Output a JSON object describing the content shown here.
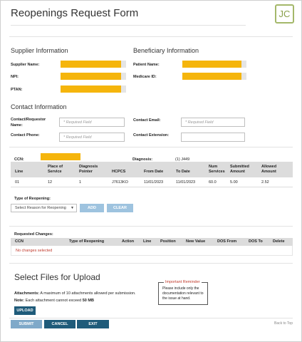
{
  "header": {
    "title": "Reopenings Request Form",
    "logo_text": "JC"
  },
  "supplier": {
    "heading": "Supplier Information",
    "name_label": "Supplier Name:",
    "npi_label": "NPI:",
    "ptan_label": "PTAN:"
  },
  "beneficiary": {
    "heading": "Beneficiary Information",
    "name_label": "Patient Name:",
    "medicare_label": "Medicare ID:"
  },
  "contact": {
    "heading": "Contact Information",
    "requestor_label": "Contact/Requestor Name:",
    "phone_label": "Contact Phone:",
    "email_label": "Contact Email:",
    "extension_label": "Contact Extension:",
    "placeholder": "* Required Field",
    "extension_value": ""
  },
  "claim": {
    "ccn_label": "CCN:",
    "diagnosis_label": "Diagnosis:",
    "diagnosis_value": "(1) J449",
    "columns": [
      "Line",
      "Place of Service",
      "Diagnosis Pointer",
      "HCPCS",
      "From Date",
      "To Date",
      "Num Services",
      "Submitted Amount",
      "Allowed Amount"
    ],
    "rows": [
      {
        "line": "01",
        "pos": "12",
        "pointer": "1",
        "hcpcs": "J7613KO",
        "from": "11/01/2023",
        "to": "11/01/2023",
        "num": "60.0",
        "submitted": "5.00",
        "allowed": "2.52"
      }
    ]
  },
  "reopening": {
    "type_label": "Type of Reopening:",
    "select_value": "Select Reason for Reopening",
    "add_label": "ADD",
    "clear_label": "CLEAR"
  },
  "requested": {
    "label": "Requested Changes:",
    "columns": [
      "CCN",
      "Type of Reopening",
      "Action",
      "Line",
      "Position",
      "New Value",
      "DOS From",
      "DOS To",
      "Delete"
    ],
    "empty_text": "No changes selected"
  },
  "upload": {
    "heading": "Select Files for Upload",
    "attachments_label": "Attachments:",
    "attachments_text": "A maximum of 10 attachments allowed per submission.",
    "note_label": "Note:",
    "note_text": "Each attachment cannot exceed",
    "note_size": "50 MB",
    "upload_label": "UPLOAD"
  },
  "reminder": {
    "title": "Important Reminder",
    "text": "Please include only the documentation relevant to the issue at hand."
  },
  "footer": {
    "submit_label": "SUBMIT",
    "cancel_label": "CANCEL",
    "exit_label": "EXIT",
    "back_to_top": "Back to Top"
  }
}
